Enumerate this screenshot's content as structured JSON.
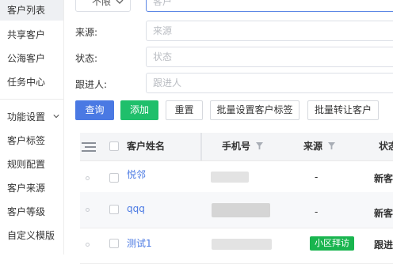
{
  "sidebar": {
    "items": [
      {
        "label": "客户列表"
      },
      {
        "label": "共享客户"
      },
      {
        "label": "公海客户"
      },
      {
        "label": "任务中心"
      }
    ],
    "group": {
      "label": "功能设置"
    },
    "sub_items": [
      {
        "label": "客户标签"
      },
      {
        "label": "规则配置"
      },
      {
        "label": "客户来源"
      },
      {
        "label": "客户等级"
      },
      {
        "label": "自定义模版"
      }
    ]
  },
  "filters": {
    "scope_select": {
      "value": "不限"
    },
    "customer_input": {
      "placeholder": "客户"
    },
    "source": {
      "label": "来源:",
      "placeholder": "来源"
    },
    "status": {
      "label": "状态:",
      "placeholder": "状态"
    },
    "follower": {
      "label": "跟进人:",
      "placeholder": "跟进人"
    }
  },
  "actions": {
    "query": "查询",
    "add": "添加",
    "reset": "重置",
    "batch_tag": "批量设置客户标签",
    "batch_transfer": "批量转让客户"
  },
  "table": {
    "columns": {
      "name": "客户姓名",
      "phone": "手机号",
      "source": "来源",
      "status": "状态"
    },
    "rows": [
      {
        "name": "悦邻",
        "source": "-",
        "status": "新客"
      },
      {
        "name": "qqq",
        "source": "-",
        "status": "新客"
      },
      {
        "name": "测试1",
        "source": "小区拜访",
        "status": "跟进"
      }
    ]
  },
  "colors": {
    "primary": "#4a79e3",
    "success": "#1fbf6b",
    "tag_green": "#19b54f",
    "link": "#4a79e3"
  }
}
